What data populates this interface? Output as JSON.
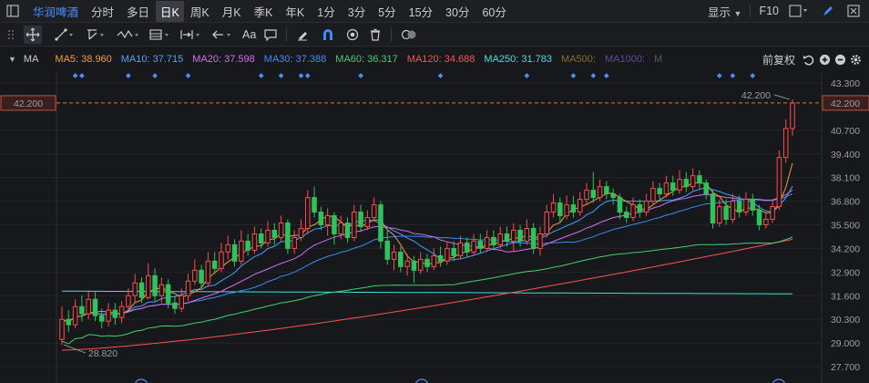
{
  "topbar": {
    "stock_name": "华润啤酒",
    "periods": [
      "分时",
      "多日",
      "日K",
      "周K",
      "月K",
      "季K",
      "年K",
      "1分",
      "3分",
      "5分",
      "15分",
      "30分",
      "60分"
    ],
    "active_period": "日K",
    "display_label": "显示",
    "f10_label": "F10"
  },
  "toolbar": {
    "text_tool_label": "Aa"
  },
  "ma_bar": {
    "label": "MA",
    "items": [
      {
        "text": "MA5: 38.960",
        "color": "#f0a030"
      },
      {
        "text": "MA10: 37.715",
        "color": "#4aa0ff"
      },
      {
        "text": "MA20: 37.598",
        "color": "#d070f0"
      },
      {
        "text": "MA30: 37.388",
        "color": "#3a8cf0"
      },
      {
        "text": "MA60: 36.317",
        "color": "#40d070"
      },
      {
        "text": "MA120: 34.688",
        "color": "#ff5050"
      },
      {
        "text": "MA250: 31.783",
        "color": "#40e0e0"
      },
      {
        "text": "MA500:",
        "color": "#8a6a2a"
      },
      {
        "text": "MA1000:",
        "color": "#5a4aa0"
      },
      {
        "text": "M",
        "color": "#555a62"
      }
    ],
    "adjust_label": "前复权"
  },
  "chart_data": {
    "type": "candlestick",
    "y_ticks": [
      "43.300",
      "42.200",
      "40.700",
      "39.400",
      "38.100",
      "36.800",
      "35.500",
      "34.200",
      "32.900",
      "31.600",
      "30.300",
      "29.000",
      "27.700"
    ],
    "current_price": "42.200",
    "high_label": "42.200",
    "low_label": "28.820",
    "up_color": "#ff4a4a",
    "down_color": "#2ec35b",
    "ylim": [
      27.7,
      43.3
    ],
    "candles": [
      [
        29.2,
        30.3,
        31.0,
        28.9
      ],
      [
        30.3,
        30.0,
        30.8,
        29.6
      ],
      [
        30.0,
        31.0,
        31.4,
        29.8
      ],
      [
        31.0,
        30.6,
        31.6,
        30.2
      ],
      [
        30.6,
        31.4,
        31.9,
        30.3
      ],
      [
        31.4,
        30.5,
        31.8,
        30.2
      ],
      [
        30.5,
        30.2,
        30.9,
        29.8
      ],
      [
        30.2,
        30.8,
        31.2,
        29.9
      ],
      [
        30.8,
        30.4,
        31.2,
        30.0
      ],
      [
        30.4,
        31.0,
        31.3,
        30.1
      ],
      [
        31.0,
        31.6,
        32.0,
        30.8
      ],
      [
        31.6,
        32.3,
        32.8,
        31.2
      ],
      [
        32.3,
        31.5,
        32.6,
        31.2
      ],
      [
        31.5,
        32.7,
        33.4,
        31.4
      ],
      [
        32.7,
        31.6,
        33.1,
        31.3
      ],
      [
        31.6,
        32.2,
        32.6,
        31.2
      ],
      [
        32.2,
        31.2,
        32.5,
        30.9
      ],
      [
        31.2,
        30.9,
        31.6,
        30.6
      ],
      [
        30.9,
        31.6,
        32.0,
        30.7
      ],
      [
        31.6,
        32.4,
        32.8,
        31.3
      ],
      [
        32.4,
        33.0,
        33.6,
        32.2
      ],
      [
        33.0,
        32.3,
        33.3,
        32.0
      ],
      [
        32.3,
        33.5,
        34.0,
        32.1
      ],
      [
        33.5,
        33.1,
        34.0,
        32.8
      ],
      [
        33.1,
        34.0,
        34.5,
        32.9
      ],
      [
        34.0,
        34.4,
        34.9,
        33.6
      ],
      [
        34.4,
        33.5,
        34.7,
        33.2
      ],
      [
        33.5,
        34.6,
        35.2,
        33.3
      ],
      [
        34.6,
        34.1,
        35.0,
        33.8
      ],
      [
        34.1,
        35.0,
        35.4,
        33.9
      ],
      [
        35.0,
        34.5,
        35.3,
        34.2
      ],
      [
        34.5,
        35.2,
        35.7,
        34.3
      ],
      [
        35.2,
        34.8,
        35.6,
        34.4
      ],
      [
        34.8,
        35.6,
        36.0,
        34.6
      ],
      [
        35.6,
        34.2,
        35.8,
        33.9
      ],
      [
        34.2,
        34.8,
        35.2,
        33.9
      ],
      [
        34.8,
        35.3,
        35.8,
        34.6
      ],
      [
        35.3,
        37.0,
        37.4,
        35.0
      ],
      [
        37.0,
        36.2,
        37.6,
        35.9
      ],
      [
        36.2,
        35.5,
        36.5,
        35.2
      ],
      [
        35.5,
        36.0,
        36.4,
        34.9
      ],
      [
        36.0,
        35.0,
        36.2,
        34.4
      ],
      [
        35.0,
        35.6,
        36.0,
        34.7
      ],
      [
        35.6,
        34.8,
        35.9,
        34.5
      ],
      [
        34.8,
        36.2,
        36.6,
        34.6
      ],
      [
        36.2,
        35.4,
        36.6,
        35.1
      ],
      [
        35.4,
        35.9,
        36.3,
        35.2
      ],
      [
        35.9,
        36.6,
        37.0,
        35.7
      ],
      [
        36.6,
        34.6,
        36.8,
        34.2
      ],
      [
        34.6,
        33.6,
        35.2,
        33.3
      ],
      [
        33.6,
        34.0,
        34.4,
        33.0
      ],
      [
        34.0,
        33.2,
        34.3,
        32.9
      ],
      [
        33.2,
        33.5,
        33.9,
        32.7
      ],
      [
        33.5,
        33.0,
        33.8,
        32.3
      ],
      [
        33.0,
        33.6,
        34.0,
        32.8
      ],
      [
        33.6,
        33.2,
        33.9,
        32.9
      ],
      [
        33.2,
        33.8,
        34.2,
        33.0
      ],
      [
        33.8,
        33.5,
        34.3,
        33.2
      ],
      [
        33.5,
        34.2,
        34.6,
        33.3
      ],
      [
        34.2,
        33.8,
        34.6,
        33.5
      ],
      [
        33.8,
        34.5,
        34.9,
        33.6
      ],
      [
        34.5,
        34.0,
        34.8,
        33.7
      ],
      [
        34.0,
        34.6,
        35.0,
        33.8
      ],
      [
        34.6,
        34.2,
        35.0,
        33.9
      ],
      [
        34.2,
        34.8,
        35.2,
        34.0
      ],
      [
        34.8,
        34.4,
        35.2,
        34.1
      ],
      [
        34.4,
        35.0,
        35.4,
        34.2
      ],
      [
        35.0,
        34.6,
        35.4,
        34.3
      ],
      [
        34.6,
        35.2,
        35.6,
        34.0
      ],
      [
        35.2,
        34.6,
        35.5,
        34.3
      ],
      [
        34.6,
        35.3,
        35.8,
        34.4
      ],
      [
        35.3,
        34.2,
        35.6,
        33.9
      ],
      [
        34.2,
        35.0,
        35.4,
        33.8
      ],
      [
        35.0,
        36.2,
        36.6,
        34.8
      ],
      [
        36.2,
        36.7,
        37.2,
        35.9
      ],
      [
        36.7,
        36.0,
        37.0,
        35.6
      ],
      [
        36.0,
        36.6,
        37.1,
        35.8
      ],
      [
        36.6,
        36.2,
        37.1,
        35.9
      ],
      [
        36.2,
        36.9,
        37.3,
        36.0
      ],
      [
        36.9,
        37.4,
        37.8,
        36.6
      ],
      [
        37.4,
        37.0,
        38.4,
        36.7
      ],
      [
        37.0,
        37.6,
        38.0,
        36.8
      ],
      [
        37.6,
        37.2,
        37.9,
        36.9
      ],
      [
        37.2,
        37.0,
        37.5,
        36.6
      ],
      [
        37.0,
        36.2,
        37.2,
        35.8
      ],
      [
        36.2,
        35.9,
        36.5,
        35.6
      ],
      [
        35.9,
        36.6,
        37.0,
        35.7
      ],
      [
        36.6,
        36.2,
        36.9,
        35.9
      ],
      [
        36.2,
        36.8,
        37.2,
        36.0
      ],
      [
        36.8,
        37.5,
        37.9,
        36.6
      ],
      [
        37.5,
        37.2,
        37.8,
        36.9
      ],
      [
        37.2,
        37.8,
        38.2,
        37.0
      ],
      [
        37.8,
        37.4,
        38.2,
        37.1
      ],
      [
        37.4,
        38.0,
        38.5,
        37.2
      ],
      [
        38.0,
        37.6,
        38.4,
        37.3
      ],
      [
        37.6,
        38.2,
        38.6,
        37.4
      ],
      [
        38.2,
        37.8,
        38.5,
        37.5
      ],
      [
        37.8,
        37.2,
        38.0,
        36.9
      ],
      [
        37.2,
        35.6,
        37.4,
        35.3
      ],
      [
        35.6,
        36.5,
        36.9,
        35.4
      ],
      [
        36.5,
        35.8,
        36.9,
        35.5
      ],
      [
        35.8,
        36.8,
        37.2,
        35.6
      ],
      [
        36.8,
        36.2,
        37.1,
        35.9
      ],
      [
        36.2,
        36.9,
        37.3,
        36.0
      ],
      [
        36.9,
        36.3,
        37.2,
        36.0
      ],
      [
        36.3,
        35.5,
        36.6,
        35.2
      ],
      [
        35.5,
        35.8,
        36.2,
        35.3
      ],
      [
        35.8,
        36.5,
        36.9,
        35.6
      ],
      [
        36.5,
        39.2,
        39.6,
        36.3
      ],
      [
        39.2,
        40.8,
        41.3,
        38.9
      ],
      [
        40.8,
        42.2,
        42.4,
        40.4
      ]
    ]
  }
}
